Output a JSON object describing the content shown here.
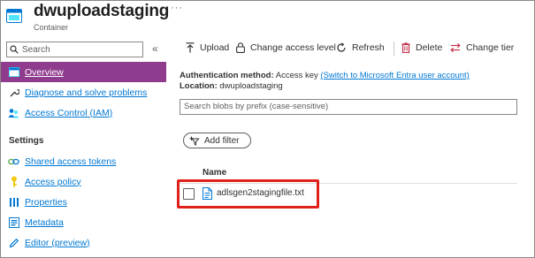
{
  "header": {
    "title": "dwuploadstaging",
    "subtitle": "Container",
    "more": "···",
    "icon": "container-icon"
  },
  "sidebar": {
    "search_placeholder": "Search",
    "collapse": "«",
    "items_top": [
      {
        "label": "Overview",
        "icon": "overview-icon",
        "active": true
      },
      {
        "label": "Diagnose and solve problems",
        "icon": "wrench-icon"
      },
      {
        "label": "Access Control (IAM)",
        "icon": "people-icon"
      }
    ],
    "settings_heading": "Settings",
    "items_settings": [
      {
        "label": "Shared access tokens",
        "icon": "link-icon"
      },
      {
        "label": "Access policy",
        "icon": "key-icon"
      },
      {
        "label": "Properties",
        "icon": "properties-icon"
      },
      {
        "label": "Metadata",
        "icon": "metadata-icon"
      },
      {
        "label": "Editor (preview)",
        "icon": "pencil-icon"
      }
    ]
  },
  "toolbar": {
    "upload": "Upload",
    "change_access_level": "Change access level",
    "refresh": "Refresh",
    "delete": "Delete",
    "change_tier": "Change tier"
  },
  "info": {
    "auth_label": "Authentication method:",
    "auth_value": "Access key",
    "auth_link": "(Switch to Microsoft Entra user account)",
    "location_label": "Location:",
    "location_value": "dwuploadstaging"
  },
  "search_blobs": {
    "placeholder": "Search blobs by prefix (case-sensitive)"
  },
  "filter": {
    "label": "Add filter"
  },
  "table": {
    "column_name": "Name",
    "rows": [
      {
        "name": "adlsgen2stagingfile.txt",
        "icon": "file-icon"
      }
    ]
  },
  "colors": {
    "accent": "#0078d4",
    "active_nav": "#8f3b8e",
    "highlight": "#e0201b",
    "delete": "#c4314b"
  }
}
